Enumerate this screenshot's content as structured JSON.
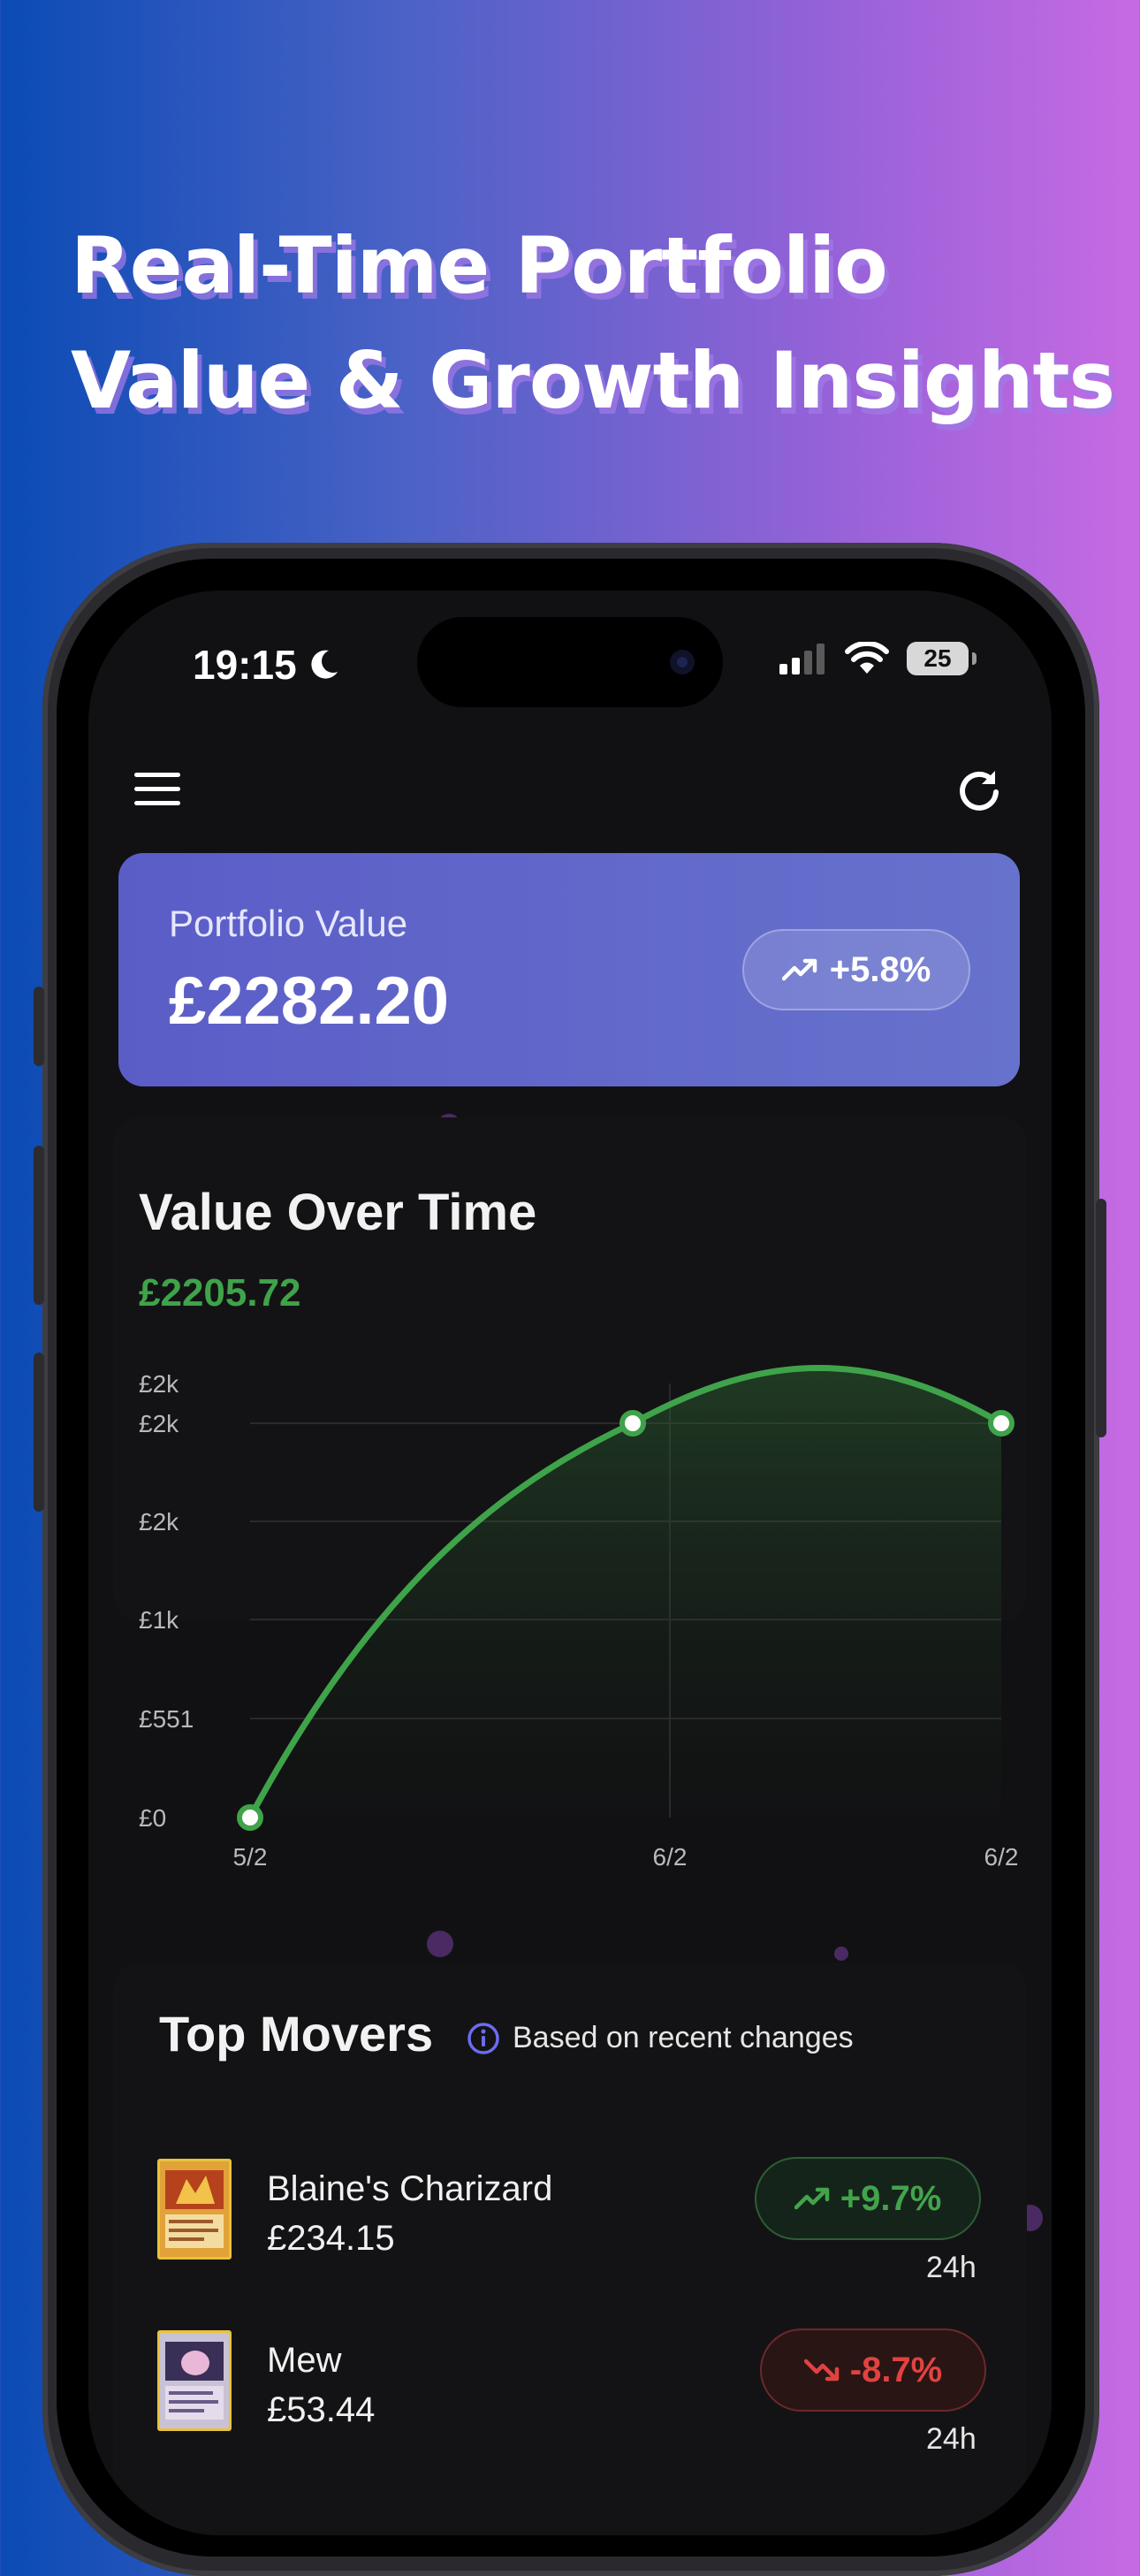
{
  "headline": {
    "line1": "Real-Time Portfolio",
    "line2": "Value & Growth Insights"
  },
  "status_bar": {
    "time": "19:15",
    "battery": "25"
  },
  "portfolio": {
    "label": "Portfolio Value",
    "value": "£2282.20",
    "change": "+5.8%"
  },
  "value_over_time": {
    "title": "Value Over Time",
    "current": "£2205.72"
  },
  "chart_data": {
    "type": "line",
    "x": [
      "5/2",
      "6/2",
      "6/2"
    ],
    "x_tick_labels": [
      "5/2",
      "6/2",
      "6/2"
    ],
    "y_tick_labels": [
      "£2k",
      "£2k",
      "£2k",
      "£1k",
      "£551",
      "£0"
    ],
    "series": [
      {
        "values": [
          0,
          2205,
          2205
        ]
      }
    ],
    "grid": true,
    "color": "#3fa34a"
  },
  "top_movers": {
    "title": "Top Movers",
    "note": "Based on recent changes",
    "items": [
      {
        "name": "Blaine's Charizard",
        "price": "£234.15",
        "change": "+9.7%",
        "period": "24h",
        "direction": "up"
      },
      {
        "name": "Mew",
        "price": "£53.44",
        "change": "-8.7%",
        "period": "24h",
        "direction": "down"
      }
    ]
  },
  "colors": {
    "accent": "#5b5dc7",
    "positive": "#3fa34a",
    "negative": "#e0433f"
  }
}
